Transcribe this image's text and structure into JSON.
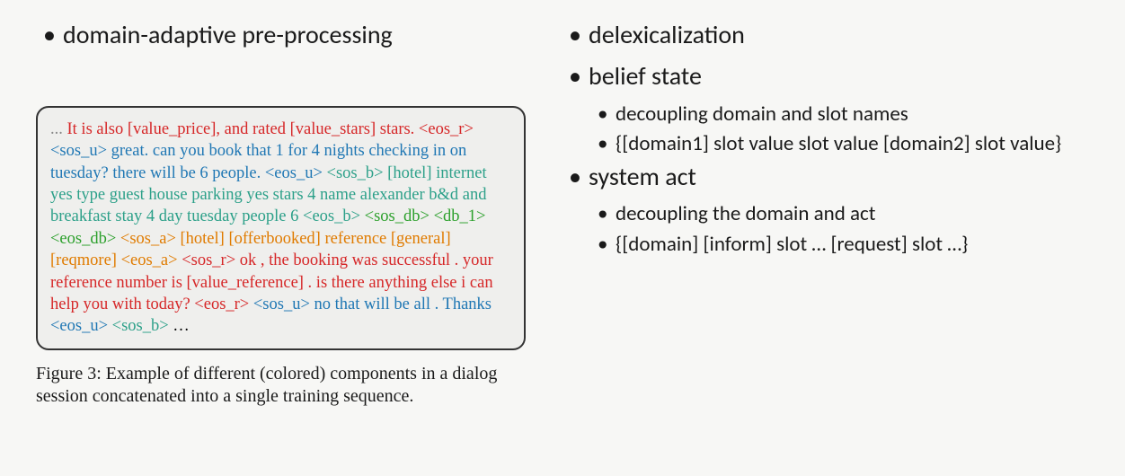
{
  "left": {
    "title": "domain-adaptive pre-processing",
    "example_tokens": [
      {
        "t": "... ",
        "c": "gray"
      },
      {
        "t": "It is also [value_price], and rated [value_stars] stars. <eos_r> ",
        "c": "red"
      },
      {
        "t": "<sos_u> great. can you book that 1 for 4 nights checking in on tuesday? there will be 6 people. <eos_u> ",
        "c": "blue"
      },
      {
        "t": "<sos_b> [hotel] internet yes type guest house parking yes stars 4 name alexander b&d and breakfast stay 4 day tuesday people 6 <eos_b> ",
        "c": "teal"
      },
      {
        "t": "<sos_db> <db_1>  <eos_db> ",
        "c": "green"
      },
      {
        "t": "<sos_a> [hotel] [offerbooked] reference [general] [reqmore] <eos_a> ",
        "c": "orange"
      },
      {
        "t": "<sos_r> ok , the booking was successful . your reference number is [value_reference] . is there anything else i can help you with today? <eos_r> ",
        "c": "red"
      },
      {
        "t": "<sos_u> no that will be all . Thanks <eos_u> ",
        "c": "blue"
      },
      {
        "t": "<sos_b> ",
        "c": "teal"
      },
      {
        "t": "…",
        "c": "black"
      }
    ],
    "caption": "Figure 3: Example of different (colored) components in a dialog session concatenated into a single training sequence."
  },
  "right": {
    "bullets": [
      {
        "level": 1,
        "text": "delexicalization"
      },
      {
        "level": 1,
        "text": "belief state"
      },
      {
        "level": 2,
        "text": "decoupling domain and slot names"
      },
      {
        "level": 2,
        "text": "{[domain1] slot value slot value [domain2] slot value}"
      },
      {
        "level": 1,
        "text": "system act"
      },
      {
        "level": 2,
        "text": "decoupling the domain and act"
      },
      {
        "level": 2,
        "text": "{[domain] [inform] slot … [request] slot …}"
      }
    ]
  }
}
